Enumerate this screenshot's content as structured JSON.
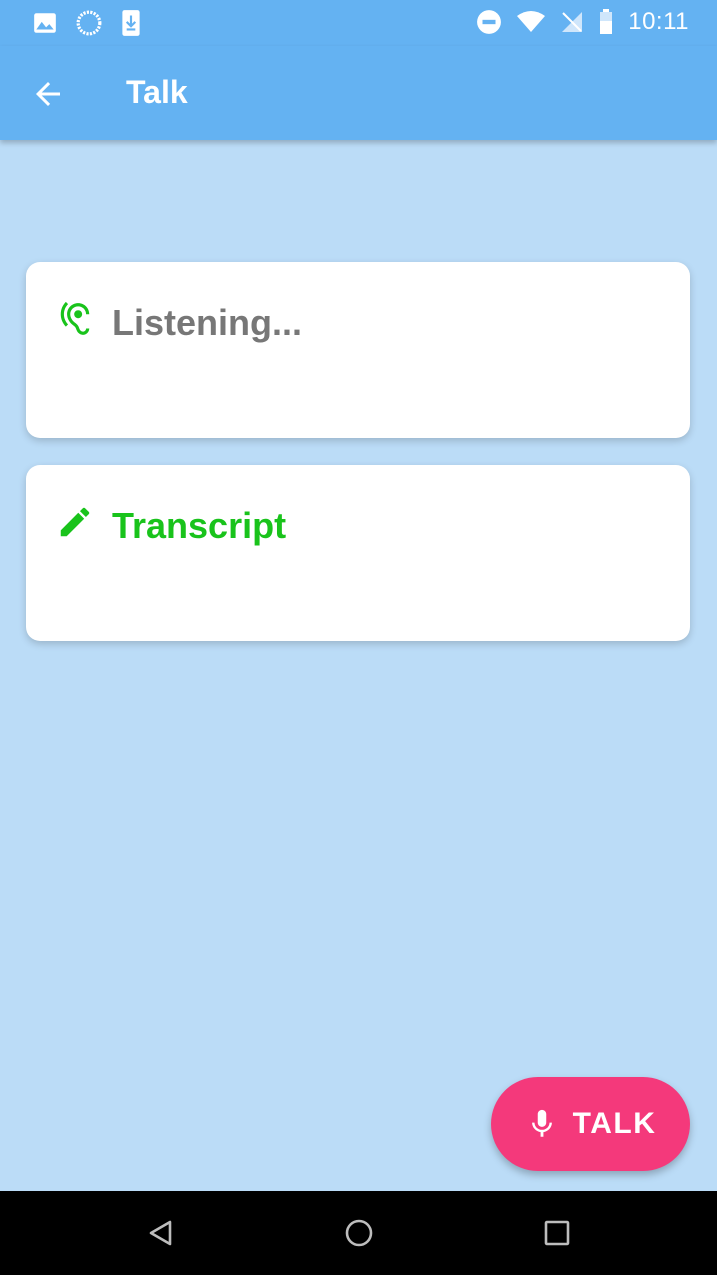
{
  "status_bar": {
    "time": "10:11",
    "left_icons": [
      "image-icon",
      "sync-progress-icon",
      "download-icon"
    ],
    "right_icons": [
      "do-not-disturb-icon",
      "wifi-icon",
      "no-signal-icon",
      "battery-icon"
    ]
  },
  "app_bar": {
    "title": "Talk",
    "back_icon": "arrow-back-icon"
  },
  "cards": {
    "listening": {
      "label": "Listening...",
      "icon": "ear-icon"
    },
    "transcript": {
      "label": "Transcript",
      "icon": "pencil-icon"
    }
  },
  "fab": {
    "label": "TALK",
    "icon": "microphone-icon"
  },
  "nav_bar": {
    "buttons": [
      "back-triangle-icon",
      "home-circle-icon",
      "recents-square-icon"
    ]
  },
  "colors": {
    "app_bar": "#64b2f2",
    "background": "#bbdcf7",
    "accent_green": "#19c31b",
    "fab_pink": "#f4397b",
    "listening_gray": "#777777"
  }
}
